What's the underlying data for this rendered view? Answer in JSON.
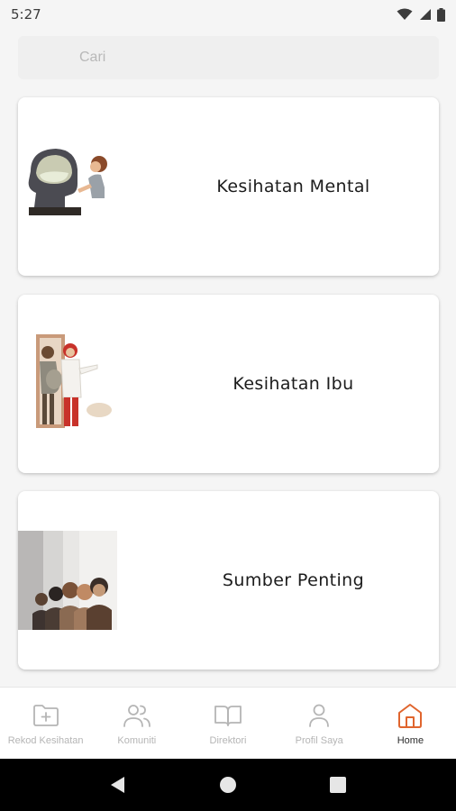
{
  "status_bar": {
    "time": "5:27"
  },
  "search": {
    "placeholder": "Cari",
    "value": ""
  },
  "cards": [
    {
      "label": "Kesihatan Mental",
      "illustration": "mental-health-illustration"
    },
    {
      "label": "Kesihatan Ibu",
      "illustration": "maternal-health-illustration"
    },
    {
      "label": "Sumber Penting",
      "illustration": "important-resources-illustration"
    }
  ],
  "bottom_nav": {
    "items": [
      {
        "label": "Rekod Kesihatan",
        "icon": "folder-plus-icon",
        "active": false
      },
      {
        "label": "Komuniti",
        "icon": "users-icon",
        "active": false
      },
      {
        "label": "Direktori",
        "icon": "book-icon",
        "active": false
      },
      {
        "label": "Profil Saya",
        "icon": "user-icon",
        "active": false
      },
      {
        "label": "Home",
        "icon": "home-icon",
        "active": true
      }
    ]
  },
  "colors": {
    "accent": "#e0652e",
    "inactive": "#b5b5b5",
    "background": "#f5f5f5"
  }
}
